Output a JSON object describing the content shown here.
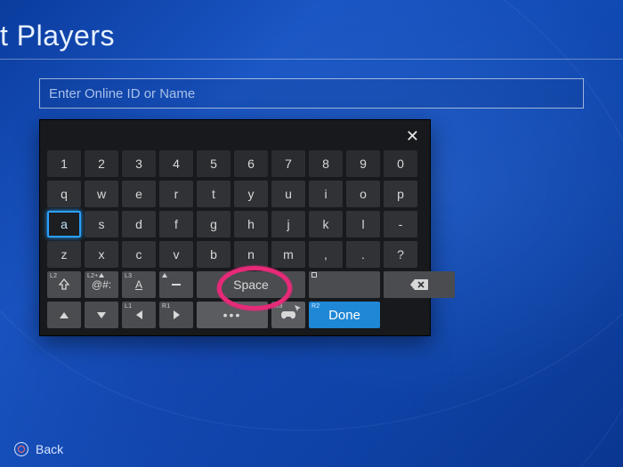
{
  "page": {
    "title_visible": "t Players",
    "input_placeholder": "Enter Online ID or Name"
  },
  "keyboard": {
    "rows": {
      "numbers": [
        "1",
        "2",
        "3",
        "4",
        "5",
        "6",
        "7",
        "8",
        "9",
        "0"
      ],
      "r1": [
        "q",
        "w",
        "e",
        "r",
        "t",
        "y",
        "u",
        "i",
        "o",
        "p"
      ],
      "r2": [
        "a",
        "s",
        "d",
        "f",
        "g",
        "h",
        "j",
        "k",
        "l",
        "-"
      ],
      "r3": [
        "z",
        "x",
        "c",
        "v",
        "b",
        "n",
        "m",
        ",",
        ".",
        "?"
      ]
    },
    "selected_key": "a",
    "row4": {
      "shift_corner": "L2",
      "sym_corner": "L2+",
      "sym_label": "@#:",
      "abc_corner": "L3",
      "abc_label": "A",
      "tri_corner": "",
      "space_label": "Space",
      "square_corner": "",
      "backspace_corner": ""
    },
    "row5": {
      "left_corner": "L1",
      "right_corner": "R1",
      "cursor_corner": "R3",
      "done_corner": "R2",
      "more_label": "•••",
      "done_label": "Done"
    }
  },
  "footer": {
    "back_label": "Back"
  },
  "colors": {
    "accent": "#1e87d6",
    "highlight": "#e62a78",
    "key_bg": "#303236"
  }
}
